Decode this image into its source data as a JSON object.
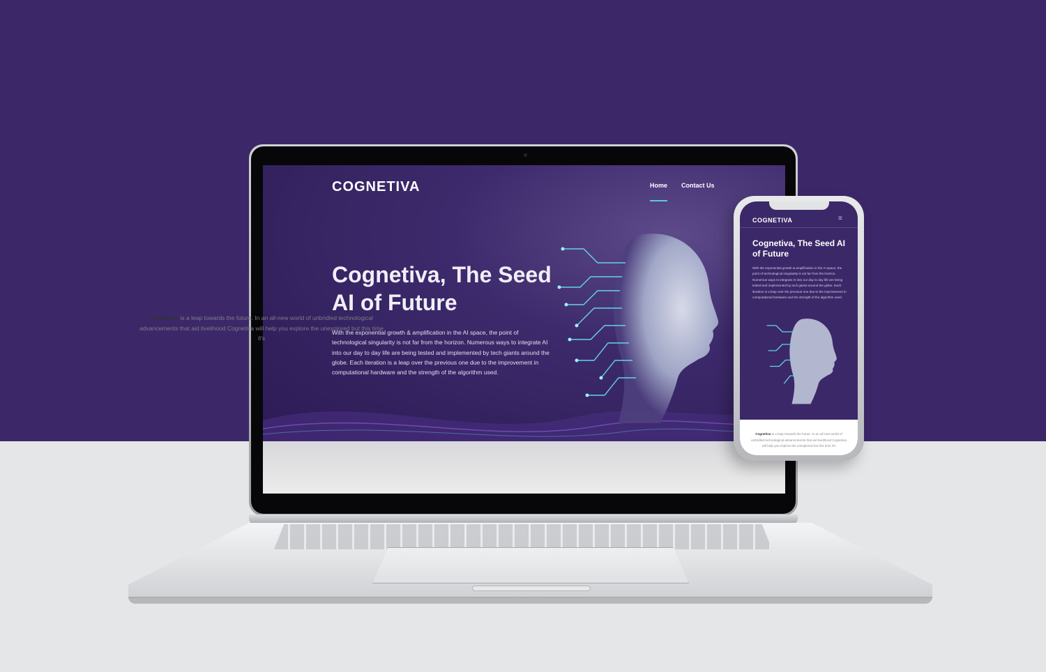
{
  "site": {
    "logo": "COGNETIVA",
    "nav": [
      {
        "label": "Home",
        "active": true
      },
      {
        "label": "Contact Us",
        "active": false
      }
    ],
    "hero": {
      "title": "Cognetiva, The Seed AI of Future",
      "text": "With the exponential growth & amplification in the AI space, the point of technological singularity is not far from the horizon. Numerous ways to integrate AI into our day to day life are being tested and implemented by tech giants around the globe. Each iteration is a leap over the previous one due to the improvement in computational hardware and the strength of the algorithm used."
    },
    "intro": {
      "brand": "Cognetiva",
      "text": "is a leap towards the future. In an all-new world of unbridled technological advancements that aid livelihood Cognetiva will help you explore the unexplored but this time it's",
      "phone_text": "is a leap towards the future. In an all-new world of unbridled technological advancements that aid livelihood Cognetiva will help you explore the unexplored but this time it's"
    }
  },
  "phone": {
    "menu_icon": "hamburger-icon",
    "menu_glyph": "≡"
  },
  "colors": {
    "background_top": "#3c2868",
    "background_bottom": "#e5e6e7",
    "hero": "#3d2a6c",
    "accent": "#5fc6e8"
  }
}
